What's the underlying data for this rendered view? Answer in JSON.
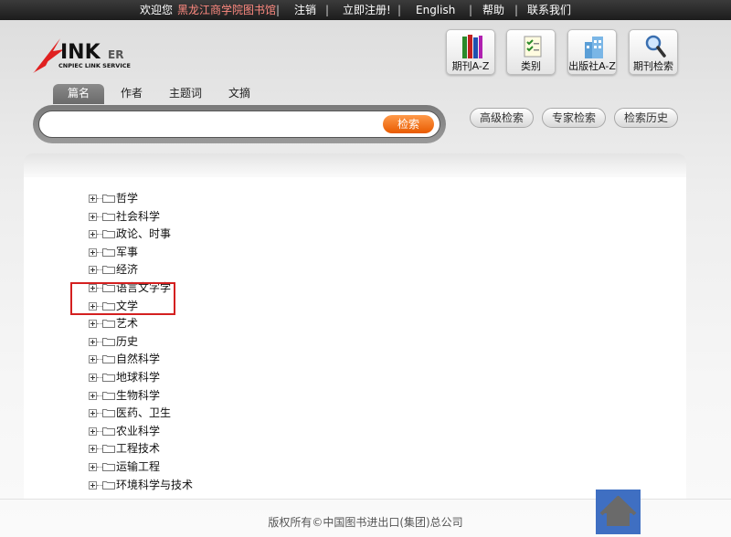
{
  "topbar": {
    "welcome": "欢迎您",
    "library": "黑龙江商学院图书馆",
    "logout": "注销",
    "register": "立即注册!",
    "english": "English",
    "help": "帮助",
    "contact": "联系我们",
    "sep": "|"
  },
  "logo": {
    "brand": "INK",
    "brand_suffix": "ER",
    "tagline": "CNPIEC LINK SERVICE"
  },
  "nav": {
    "journal_az": "期刊A-Z",
    "category": "类别",
    "publisher_az": "出版社A-Z",
    "journal_search": "期刊检索"
  },
  "search": {
    "tabs": [
      "篇名",
      "作者",
      "主题词",
      "文摘"
    ],
    "active_tab": "篇名",
    "value": "",
    "placeholder": "",
    "submit_label": "检索"
  },
  "actions": {
    "advanced": "高级检索",
    "expert": "专家检索",
    "history": "检索历史"
  },
  "tree": {
    "items": [
      "哲学",
      "社会科学",
      "政论、时事",
      "军事",
      "经济",
      "语言文字学",
      "文学",
      "艺术",
      "历史",
      "自然科学",
      "地球科学",
      "生物科学",
      "医药、卫生",
      "农业科学",
      "工程技术",
      "运输工程",
      "环境科学与技术"
    ]
  },
  "footer": {
    "copyright": "版权所有©中国图书进出口(集团)总公司"
  },
  "colors": {
    "accent": "#e85a00",
    "highlight": "#d42020",
    "home": "#3f6fc2"
  }
}
